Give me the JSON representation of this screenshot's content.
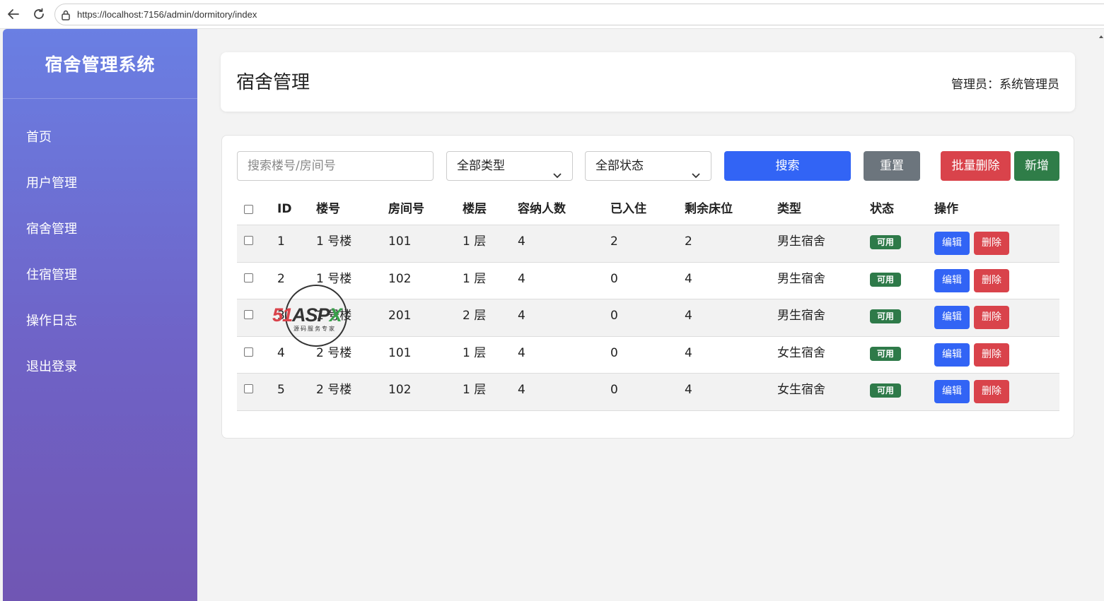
{
  "browser": {
    "url": "https://localhost:7156/admin/dormitory/index"
  },
  "sidebar": {
    "brand": "宿舍管理系统",
    "items": [
      {
        "label": "首页"
      },
      {
        "label": "用户管理"
      },
      {
        "label": "宿舍管理"
      },
      {
        "label": "住宿管理"
      },
      {
        "label": "操作日志"
      },
      {
        "label": "退出登录"
      }
    ]
  },
  "header": {
    "title": "宿舍管理",
    "admin": "管理员：系统管理员"
  },
  "toolbar": {
    "search_placeholder": "搜索楼号/房间号",
    "type_select": "全部类型",
    "status_select": "全部状态",
    "search_label": "搜索",
    "reset_label": "重置",
    "batch_delete_label": "批量删除",
    "add_label": "新增"
  },
  "table": {
    "columns": [
      "ID",
      "楼号",
      "房间号",
      "楼层",
      "容纳人数",
      "已入住",
      "剩余床位",
      "类型",
      "状态",
      "操作"
    ],
    "rows": [
      {
        "id": "1",
        "building": "1 号楼",
        "room": "101",
        "floor": "1 层",
        "capacity": "4",
        "occupied": "2",
        "remaining": "2",
        "type": "男生宿舍",
        "status": "可用"
      },
      {
        "id": "2",
        "building": "1 号楼",
        "room": "102",
        "floor": "1 层",
        "capacity": "4",
        "occupied": "0",
        "remaining": "4",
        "type": "男生宿舍",
        "status": "可用"
      },
      {
        "id": "3",
        "building": "1 号楼",
        "room": "201",
        "floor": "2 层",
        "capacity": "4",
        "occupied": "0",
        "remaining": "4",
        "type": "男生宿舍",
        "status": "可用"
      },
      {
        "id": "4",
        "building": "2 号楼",
        "room": "101",
        "floor": "1 层",
        "capacity": "4",
        "occupied": "0",
        "remaining": "4",
        "type": "女生宿舍",
        "status": "可用"
      },
      {
        "id": "5",
        "building": "2 号楼",
        "room": "102",
        "floor": "1 层",
        "capacity": "4",
        "occupied": "0",
        "remaining": "4",
        "type": "女生宿舍",
        "status": "可用"
      }
    ],
    "edit_label": "编辑",
    "delete_label": "删除"
  },
  "watermark": {
    "logo": "51ASPX",
    "tagline": "源码服务专家"
  },
  "colors": {
    "primary": "#3264f5",
    "danger": "#d9434b",
    "success": "#2f7d48",
    "secondary": "#6c757d",
    "sidebar_top": "#6a7fe3",
    "sidebar_bottom": "#7056b3"
  }
}
